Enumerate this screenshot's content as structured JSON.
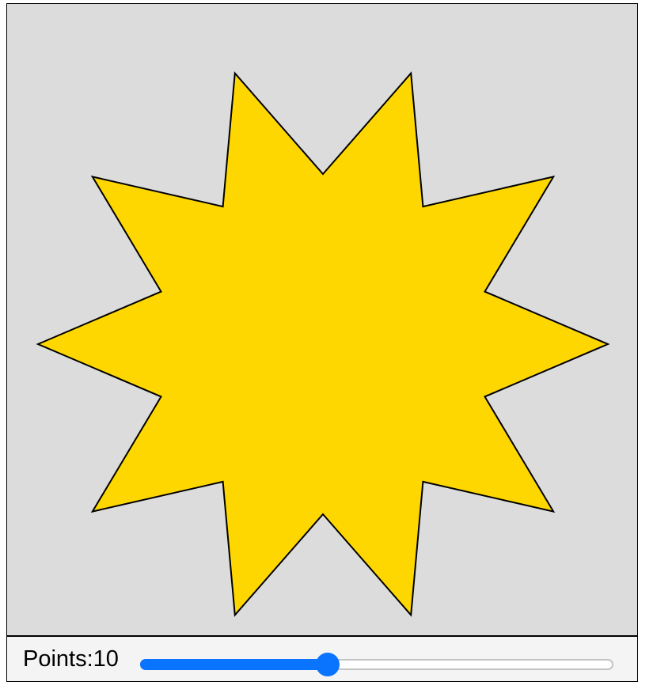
{
  "star": {
    "points": 10,
    "fill_color": "#ffd700",
    "stroke_color": "#000000",
    "background_color": "#dcdcdc"
  },
  "controls": {
    "label": "Points:",
    "value": "10",
    "slider": {
      "min": 3,
      "max": 20,
      "value": 10,
      "fraction": 0.39,
      "active_color": "#0a74ff",
      "track_color": "#ffffff",
      "track_border_color": "#c4c4c4",
      "panel_color": "#f4f4f4"
    }
  }
}
